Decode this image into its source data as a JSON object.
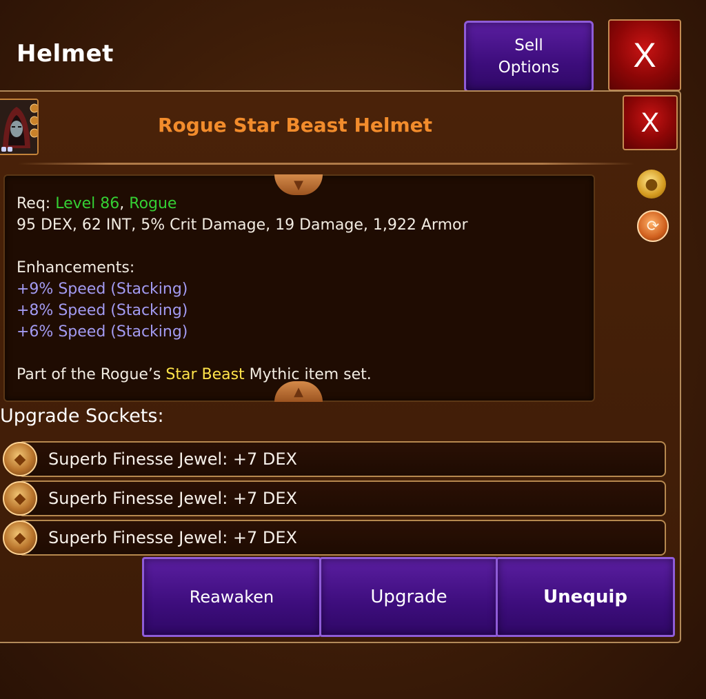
{
  "header": {
    "title": "Helmet",
    "sell_label": "Sell\nOptions",
    "close_label": "X"
  },
  "item": {
    "name": "Rogue Star Beast Helmet",
    "close_label": "X",
    "req_prefix": "Req: ",
    "req_level": "Level 86",
    "req_sep": ", ",
    "req_class": "Rogue",
    "stats": "95 DEX, 62 INT, 5% Crit Damage, 19 Damage, 1,922 Armor",
    "enhancements_label": "Enhancements:",
    "enhancements": [
      "+9% Speed (Stacking)",
      "+8% Speed (Stacking)",
      "+6% Speed (Stacking)"
    ],
    "set_prefix": "Part of the Rogue’s ",
    "set_name": "Star Beast",
    "set_suffix": " Mythic item set."
  },
  "sockets": {
    "label": "Upgrade Sockets:",
    "items": [
      "Superb Finesse Jewel: +7 DEX",
      "Superb Finesse Jewel: +7 DEX",
      "Superb Finesse Jewel: +7 DEX"
    ]
  },
  "actions": {
    "reawaken": "Reawaken",
    "upgrade": "Upgrade",
    "unequip": "Unequip"
  },
  "colors": {
    "title_orange": "#f28c2c",
    "req_green": "#35d034",
    "enh_purple": "#a39bf2",
    "set_yellow": "#ffe44a",
    "button_purple": "#3d0d7c",
    "close_red": "#c81414"
  },
  "icons": {
    "item": "hooded-rogue-portrait-icon",
    "bag": "gold-bag-icon",
    "swap": "swap-cycle-icon",
    "gem": "finesse-jewel-icon"
  }
}
